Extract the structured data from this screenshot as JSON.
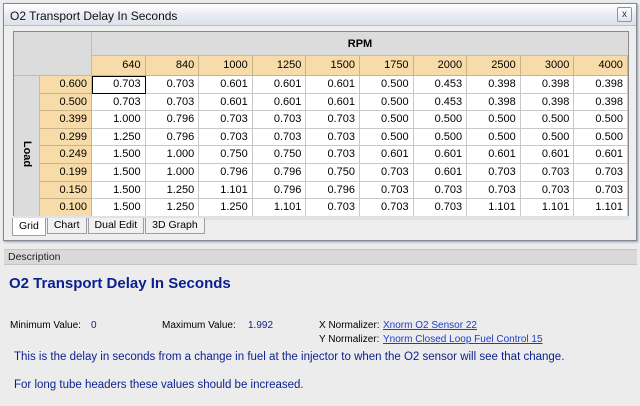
{
  "window": {
    "title": "O2 Transport Delay In Seconds",
    "close_glyph": "x"
  },
  "table": {
    "column_axis_label": "RPM",
    "row_axis_label": "Load",
    "columns": [
      "640",
      "840",
      "1000",
      "1250",
      "1500",
      "1750",
      "2000",
      "2500",
      "3000",
      "4000"
    ],
    "rows": [
      {
        "load": "0.600",
        "values": [
          "0.703",
          "0.703",
          "0.601",
          "0.601",
          "0.601",
          "0.500",
          "0.453",
          "0.398",
          "0.398",
          "0.398"
        ]
      },
      {
        "load": "0.500",
        "values": [
          "0.703",
          "0.703",
          "0.601",
          "0.601",
          "0.601",
          "0.500",
          "0.453",
          "0.398",
          "0.398",
          "0.398"
        ]
      },
      {
        "load": "0.399",
        "values": [
          "1.000",
          "0.796",
          "0.703",
          "0.703",
          "0.703",
          "0.500",
          "0.500",
          "0.500",
          "0.500",
          "0.500"
        ]
      },
      {
        "load": "0.299",
        "values": [
          "1.250",
          "0.796",
          "0.703",
          "0.703",
          "0.703",
          "0.500",
          "0.500",
          "0.500",
          "0.500",
          "0.500"
        ]
      },
      {
        "load": "0.249",
        "values": [
          "1.500",
          "1.000",
          "0.750",
          "0.750",
          "0.703",
          "0.601",
          "0.601",
          "0.601",
          "0.601",
          "0.601"
        ]
      },
      {
        "load": "0.199",
        "values": [
          "1.500",
          "1.000",
          "0.796",
          "0.796",
          "0.750",
          "0.703",
          "0.601",
          "0.703",
          "0.703",
          "0.703"
        ]
      },
      {
        "load": "0.150",
        "values": [
          "1.500",
          "1.250",
          "1.101",
          "0.796",
          "0.796",
          "0.703",
          "0.703",
          "0.703",
          "0.703",
          "0.703"
        ]
      },
      {
        "load": "0.100",
        "values": [
          "1.500",
          "1.250",
          "1.250",
          "1.101",
          "0.703",
          "0.703",
          "0.703",
          "1.101",
          "1.101",
          "1.101"
        ]
      }
    ]
  },
  "tabs": [
    "Grid",
    "Chart",
    "Dual Edit",
    "3D Graph"
  ],
  "description": {
    "header": "Description",
    "title": "O2 Transport Delay In Seconds",
    "min_label": "Minimum Value:",
    "min_value": "0",
    "max_label": "Maximum Value:",
    "max_value": "1.992",
    "x_norm_label": "X Normalizer:",
    "x_norm_link": "Xnorm O2 Sensor 22",
    "y_norm_label": "Y Normalizer:",
    "y_norm_link": "Ynorm Closed Loop Fuel Control 15",
    "text1": "This is the delay in seconds from a change in fuel at the injector to when the O2 sensor will see that change.",
    "text2": "For long tube headers these values should be increased."
  }
}
